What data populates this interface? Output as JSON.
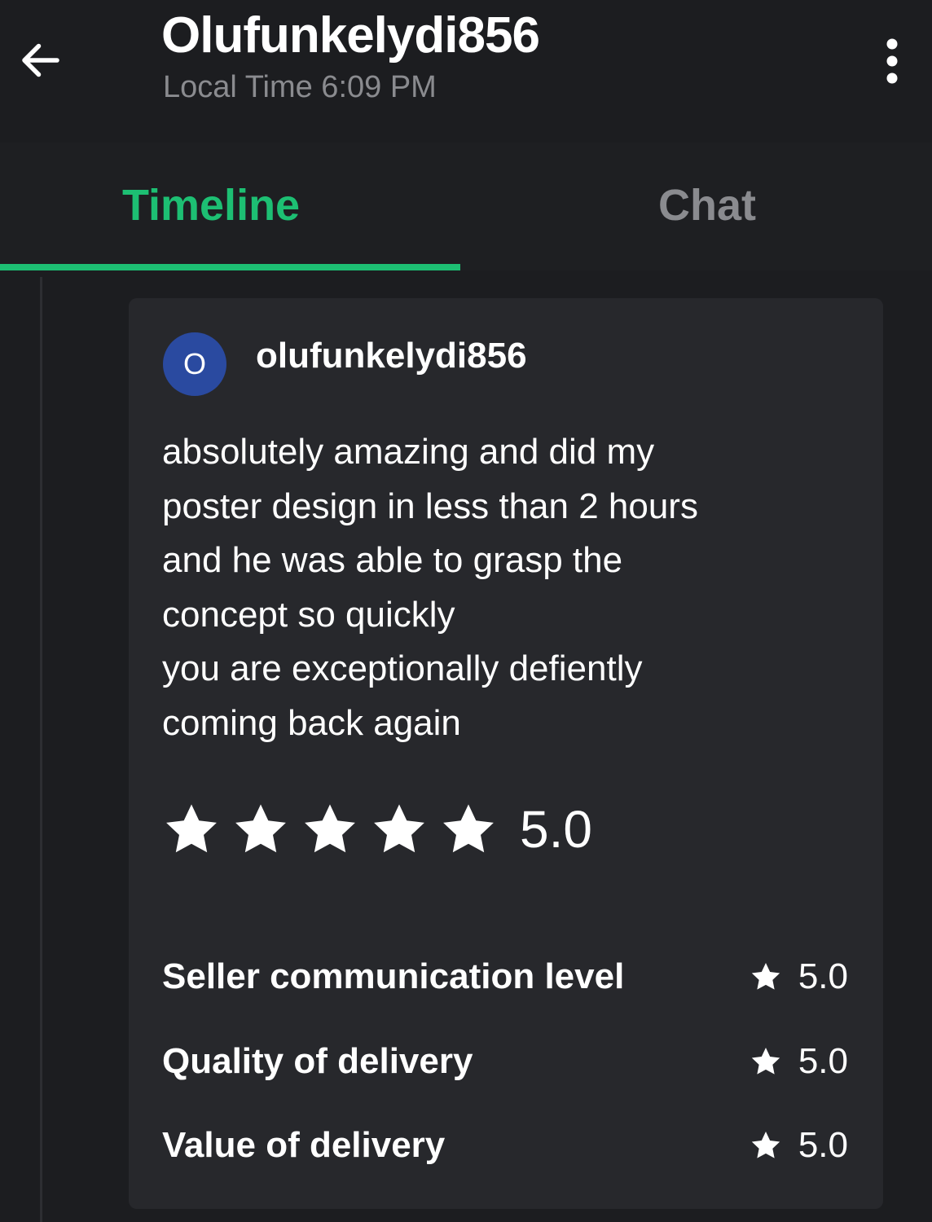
{
  "header": {
    "title": "Olufunkelydi856",
    "subtitle": "Local Time 6:09 PM",
    "back_icon": "arrow-left-icon",
    "more_icon": "more-vertical-icon"
  },
  "tabs": [
    {
      "label": "Timeline",
      "active": true
    },
    {
      "label": "Chat",
      "active": false
    }
  ],
  "colors": {
    "accent": "#1dbf73",
    "background": "#1c1d20",
    "card": "#27282c",
    "avatar": "#2a4aa0"
  },
  "review": {
    "avatar_letter": "O",
    "username": "olufunkelydi856",
    "text_lines": [
      "absolutely amazing and did my",
      "poster design in less than 2 hours",
      "and he was able to grasp the",
      "concept so quickly",
      "you are exceptionally defiently",
      "coming back again"
    ],
    "rating": "5.0",
    "stars_filled": 5,
    "stars_total": 5,
    "metrics": [
      {
        "label": "Seller communication level",
        "value": "5.0"
      },
      {
        "label": "Quality of delivery",
        "value": "5.0"
      },
      {
        "label": "Value of delivery",
        "value": "5.0"
      }
    ]
  }
}
